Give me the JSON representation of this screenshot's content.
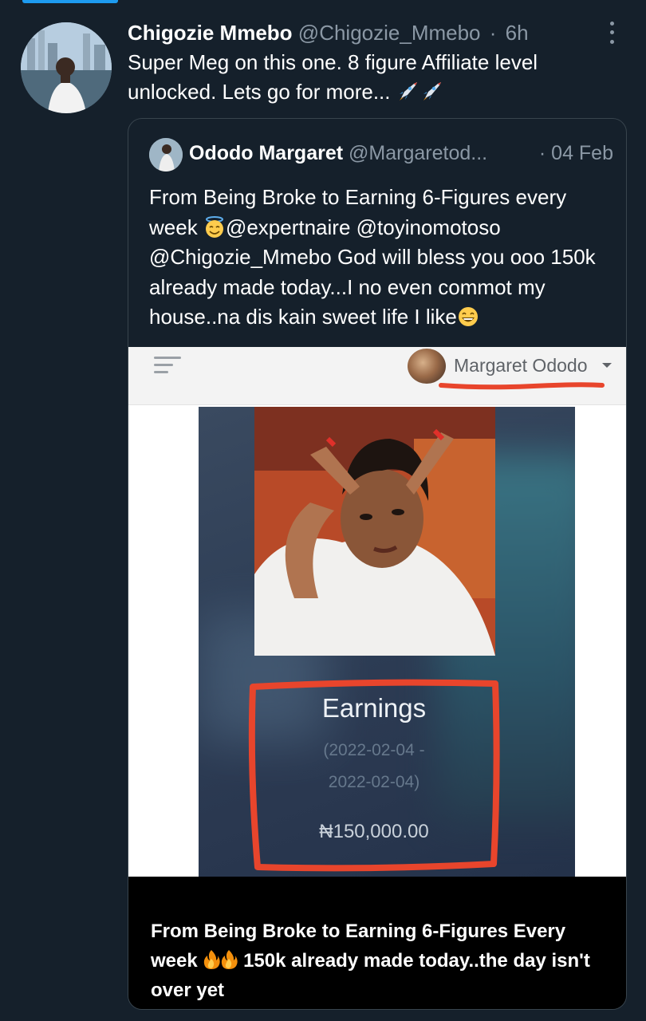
{
  "tweet": {
    "author_name": "Chigozie Mmebo",
    "author_handle": "@Chigozie_Mmebo",
    "separator": "·",
    "time": "6h",
    "text": "Super Meg on this one. 8 figure Affiliate level unlocked. Lets go for more...",
    "text_emoji": [
      "rocket-icon",
      "rocket-icon"
    ]
  },
  "quoted_tweet": {
    "author_name": "Ododo Margaret",
    "author_handle": "@Margaretod...",
    "date": "· 04 Feb",
    "text_part1": "From Being Broke to Earning 6-Figures every week",
    "text_part2": "@expertnaire @toyinomotoso @Chigozie_Mmebo God will bless you ooo 150k already made today...I no even commot my house..na dis kain sweet life I like",
    "emoji_1": "smiling-face-with-halo-icon",
    "emoji_2": "grinning-face-icon"
  },
  "embedded_screenshot": {
    "user_name": "Margaret Ododo",
    "earnings_title": "Earnings",
    "earnings_range_start": "(2022-02-04 -",
    "earnings_range_end": "2022-02-04)",
    "earnings_amount": "₦150,000.00",
    "highlight_color": "#e8452c"
  },
  "caption": {
    "text_part1": "From Being Broke to Earning 6-Figures Every week",
    "text_part2": "150k already made today..the day isn't over yet",
    "emoji": [
      "fire-icon",
      "fire-icon"
    ]
  },
  "colors": {
    "background": "#15202b",
    "secondary_text": "#8b98a5",
    "border": "#38444d",
    "accent": "#1d9bf0"
  }
}
